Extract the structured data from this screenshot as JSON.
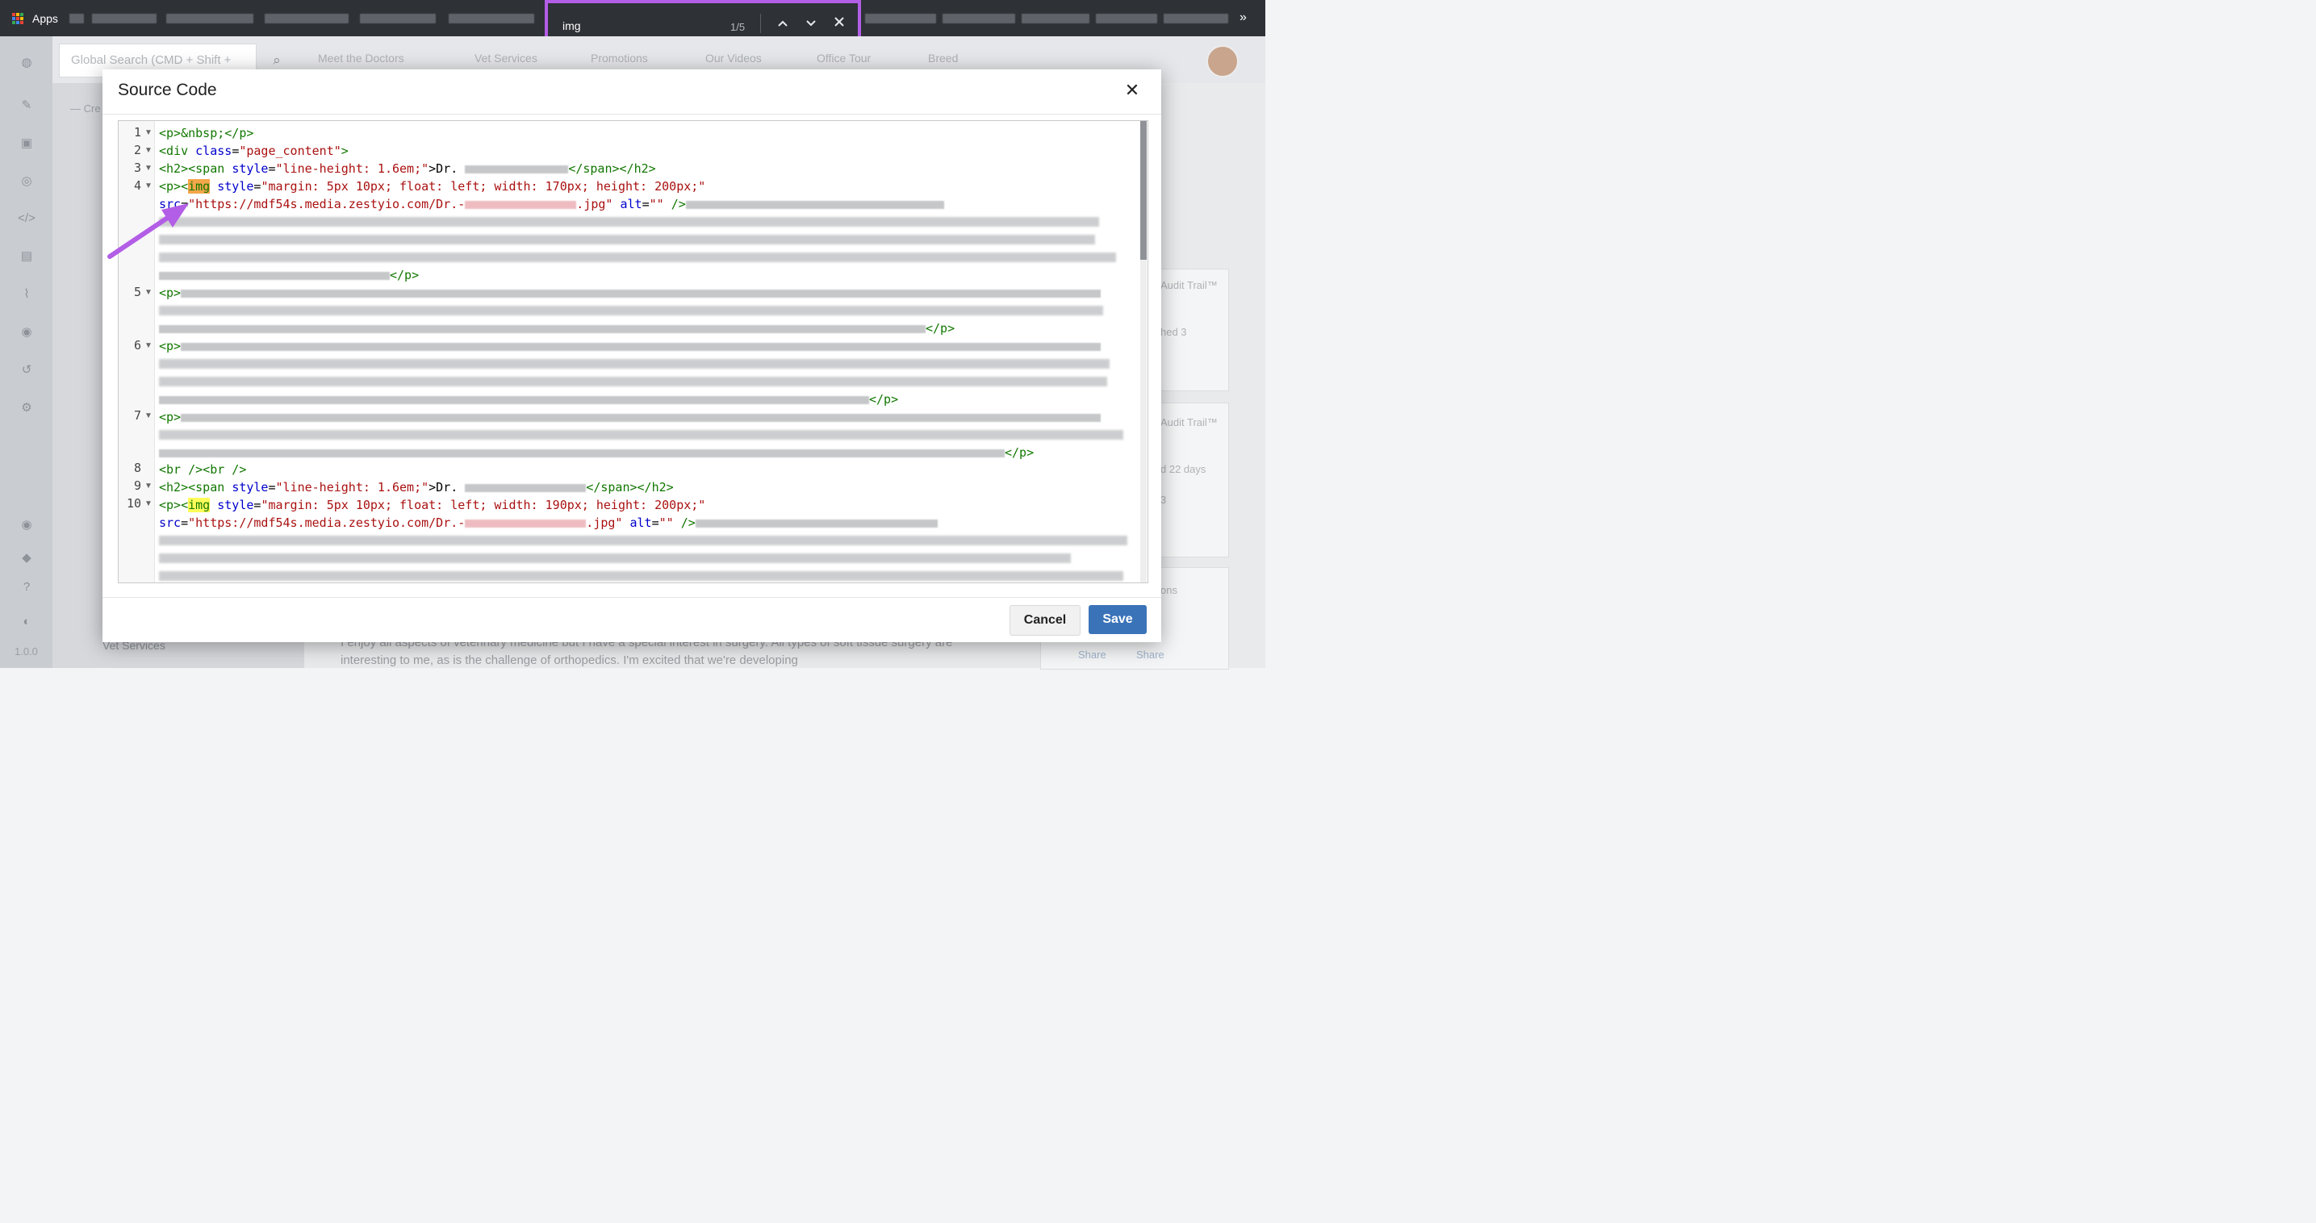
{
  "browser": {
    "apps_label": "Apps",
    "overflow_icon": "»",
    "find": {
      "query": "img",
      "count": "1/5",
      "prev_icon": "chevron-up",
      "next_icon": "chevron-down",
      "close_icon": "close",
      "highlight_color": "#b35ee6"
    }
  },
  "cms": {
    "search_placeholder": "Global Search (CMD + Shift +",
    "tabs": [
      "Meet the Doctors",
      "Vet Services",
      "Promotions",
      "Our Videos",
      "Office Tour",
      "Breed"
    ],
    "left_panel": {
      "create_label": "— Cre",
      "bottom_item": "Vet Services",
      "version": "1.0.0"
    },
    "background_text": {
      "audit_1": "Audit Trail™",
      "audit_2": "Audit Trail™",
      "published": "hed 3",
      "days": "d 22 days",
      "three": "3",
      "ons": "ons",
      "share_1": "Share",
      "share_2": "Share",
      "paragraph": "I enjoy all aspects of veterinary medicine but I have a special interest in surgery. All types of soft tissue surgery are interesting to me, as is the challenge of orthopedics. I'm excited that we're developing"
    }
  },
  "modal": {
    "title": "Source Code",
    "cancel_label": "Cancel",
    "save_label": "Save",
    "line_numbers": [
      "1",
      "2",
      "3",
      "4",
      "",
      "",
      "",
      "",
      "5",
      "",
      "",
      "6",
      "",
      "",
      "",
      "7",
      "",
      "",
      "8",
      "9",
      "10",
      "",
      "",
      ""
    ],
    "code": {
      "l1": "<p>&nbsp;</p>",
      "l2_open": "<div ",
      "l2_attr": "class",
      "l2_val": "\"page_content\"",
      "l3_tag": "<h2><span ",
      "l3_attr": "style",
      "l3_val": "\"line-height: 1.6em;\"",
      "l3_text": ">Dr. ",
      "l3_close": "</span></h2>",
      "l4_open": "<p><",
      "img": "img",
      "l4_style_attr": " style",
      "l4_style_val": "\"margin: 5px 10px; float: left; width: 170px; height: 200px;\"",
      "src_attr": "src",
      "l4_src_val_a": "\"https://mdf54s.media.zestyio.com/Dr.-",
      "l4_src_val_b": ".jpg\"",
      "alt_attr": " alt",
      "alt_val": "\"\"",
      "self_close": " />",
      "p_close": "</p>",
      "p_open": "<p>",
      "l8": "<br /><br />",
      "l10_style_val": "\"margin: 5px 10px; float: left; width: 190px; height: 200px;\""
    }
  }
}
